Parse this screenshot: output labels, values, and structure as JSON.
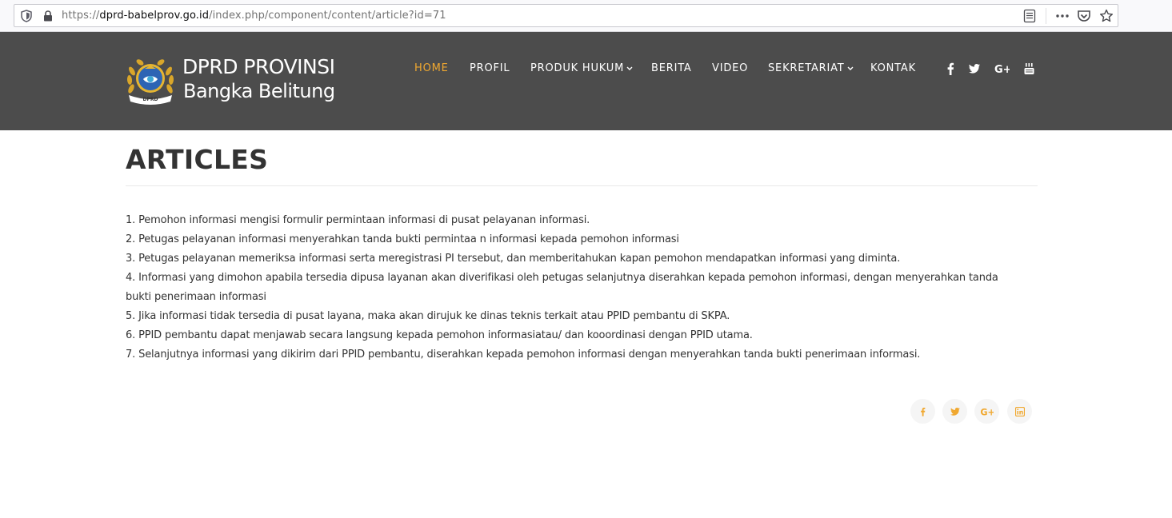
{
  "browser": {
    "url_prefix": "https://",
    "url_host": "dprd-babelprov.go.id",
    "url_path": "/index.php/component/content/article?id=71",
    "icons": [
      "shield-icon",
      "lock-icon",
      "reader-view-icon",
      "more-icon",
      "pocket-icon",
      "bookmark-star-icon"
    ]
  },
  "header": {
    "logo_line1": "DPRD PROVINSI",
    "logo_line2": "Bangka Belitung",
    "logo_badge": "DPRD",
    "nav": [
      {
        "label": "HOME",
        "active": true
      },
      {
        "label": "PROFIL"
      },
      {
        "label": "PRODUK HUKUM",
        "dropdown": true
      },
      {
        "label": "BERITA"
      },
      {
        "label": "VIDEO"
      },
      {
        "label": "SEKRETARIAT",
        "dropdown": true
      },
      {
        "label": "KONTAK"
      }
    ],
    "social": [
      "facebook-icon",
      "twitter-icon",
      "google-plus-icon",
      "youtube-icon"
    ]
  },
  "main": {
    "title": "ARTICLES",
    "items": [
      "1. Pemohon informasi mengisi formulir permintaan informasi di pusat pelayanan informasi.",
      "2. Petugas pelayanan informasi menyerahkan tanda bukti permintaa n informasi kepada pemohon informasi",
      "3. Petugas pelayanan memeriksa informasi serta meregistrasi PI tersebut, dan memberitahukan kapan pemohon mendapatkan informasi yang diminta.",
      "4. Informasi yang dimohon apabila tersedia dipusa layanan akan diverifikasi oleh petugas selanjutnya diserahkan kepada pemohon informasi, dengan menyerahkan tanda bukti penerimaan informasi",
      "5. Jika informasi tidak tersedia di pusat layana, maka akan dirujuk ke dinas teknis terkait atau PPID pembantu di SKPA.",
      "6. PPID pembantu dapat menjawab secara langsung kepada pemohon informasiatau/ dan kooordinasi dengan PPID utama.",
      "7. Selanjutnya informasi yang dikirim dari PPID pembantu, diserahkan kepada pemohon informasi dengan menyerahkan tanda bukti penerimaan informasi."
    ],
    "share": [
      "facebook-icon",
      "twitter-icon",
      "google-plus-icon",
      "linkedin-icon"
    ]
  },
  "colors": {
    "header_bg": "#4c4c4c",
    "accent": "#f0a830",
    "text": "#333333"
  }
}
